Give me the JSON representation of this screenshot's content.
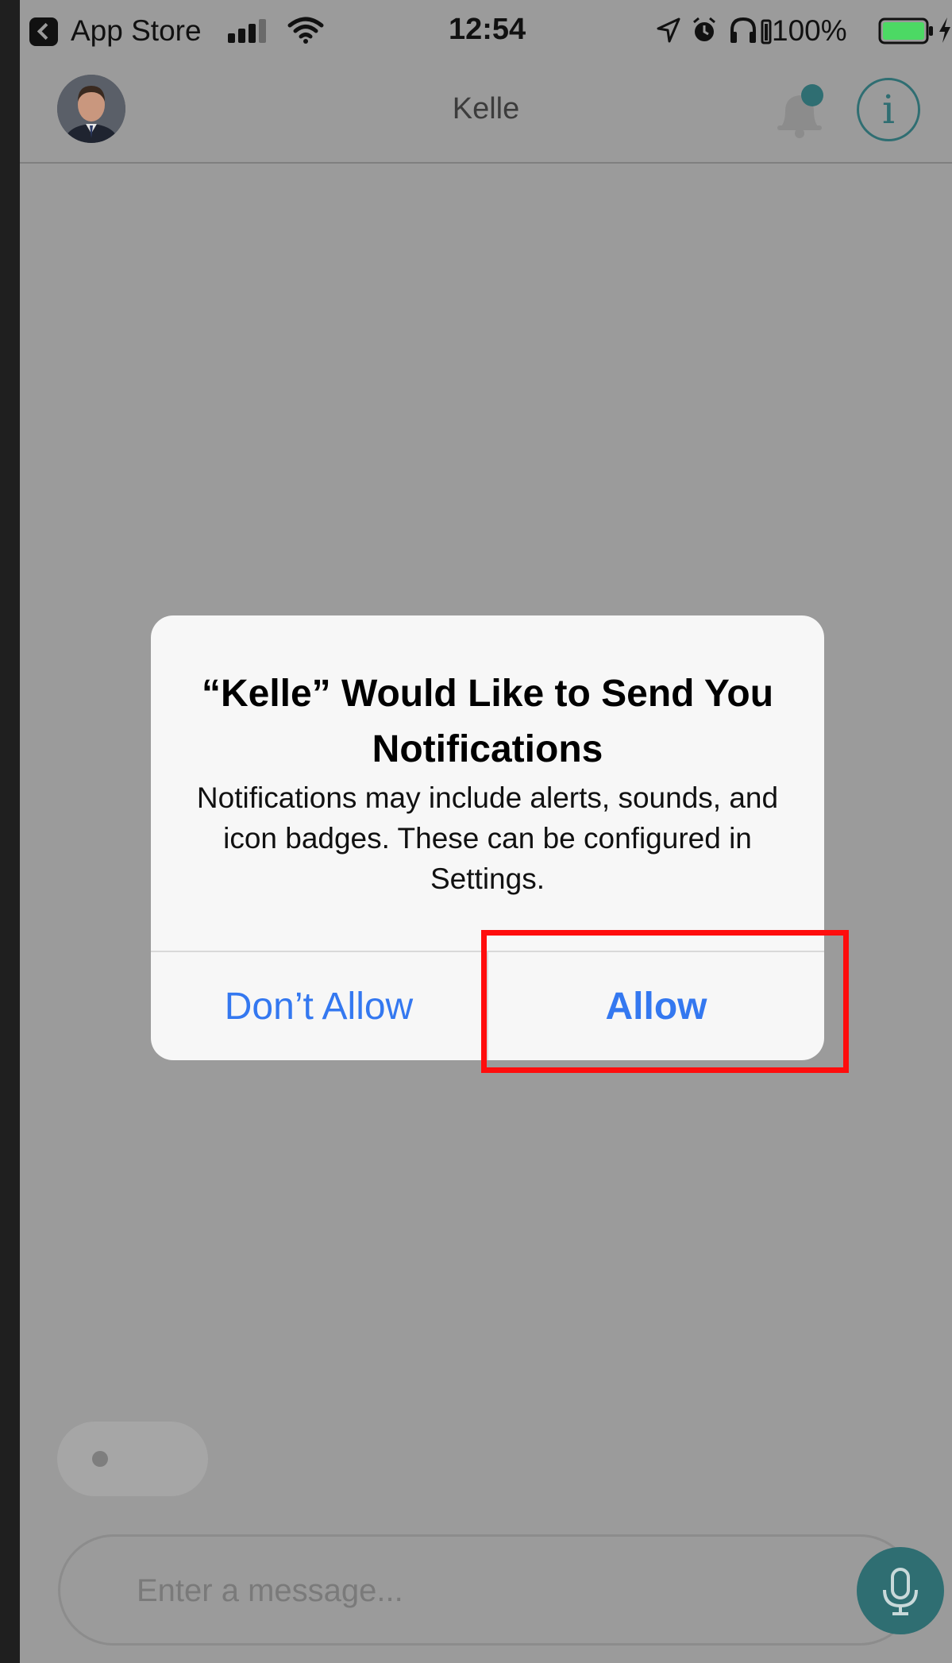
{
  "status_bar": {
    "back_app": "App Store",
    "time": "12:54",
    "battery_percent": "100%",
    "battery_level": 1.0
  },
  "nav": {
    "title": "Kelle",
    "left_icon": "user-avatar",
    "right_icons": [
      "bell-icon",
      "info-icon"
    ],
    "info_glyph": "i"
  },
  "alert": {
    "title": "“Kelle” Would Like to Send You Notifications",
    "message": "Notifications may include alerts, sounds, and icon badges. These can be configured in Settings.",
    "dont_allow_label": "Don’t Allow",
    "allow_label": "Allow"
  },
  "composer": {
    "placeholder": "Enter a message...",
    "mic_icon": "microphone-icon"
  },
  "colors": {
    "accent": "#2f6e72",
    "alert_button": "#3478f0",
    "highlight": "#ff0d0d",
    "battery": "#4cd964"
  }
}
